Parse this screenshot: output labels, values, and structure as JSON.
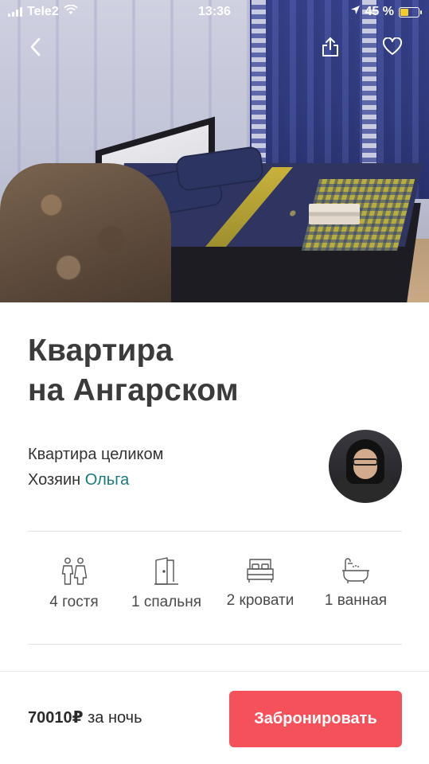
{
  "status_bar": {
    "carrier": "Tele2",
    "time": "13:36",
    "battery_percent": "45 %",
    "battery_level": 0.45,
    "battery_color": "#f5cc2a"
  },
  "hero": {
    "icons": {
      "back": "chevron-left-icon",
      "share": "share-icon",
      "favorite": "heart-icon"
    }
  },
  "listing": {
    "title_line1": "Квартира",
    "title_line2": "на Ангарском",
    "property_type": "Квартира целиком",
    "host_prefix": "Хозяин",
    "host_name": "Ольга",
    "host_link_color": "#177b7b"
  },
  "amenities": [
    {
      "icon": "guests-icon",
      "label": "4 гостя"
    },
    {
      "icon": "door-icon",
      "label": "1 спальня"
    },
    {
      "icon": "bed-icon",
      "label": "2 кровати"
    },
    {
      "icon": "bathtub-icon",
      "label": "1 ванная"
    }
  ],
  "footer": {
    "price": "70010₽",
    "price_suffix": "за ночь",
    "book_label": "Забронировать",
    "book_color": "#f5515b"
  }
}
